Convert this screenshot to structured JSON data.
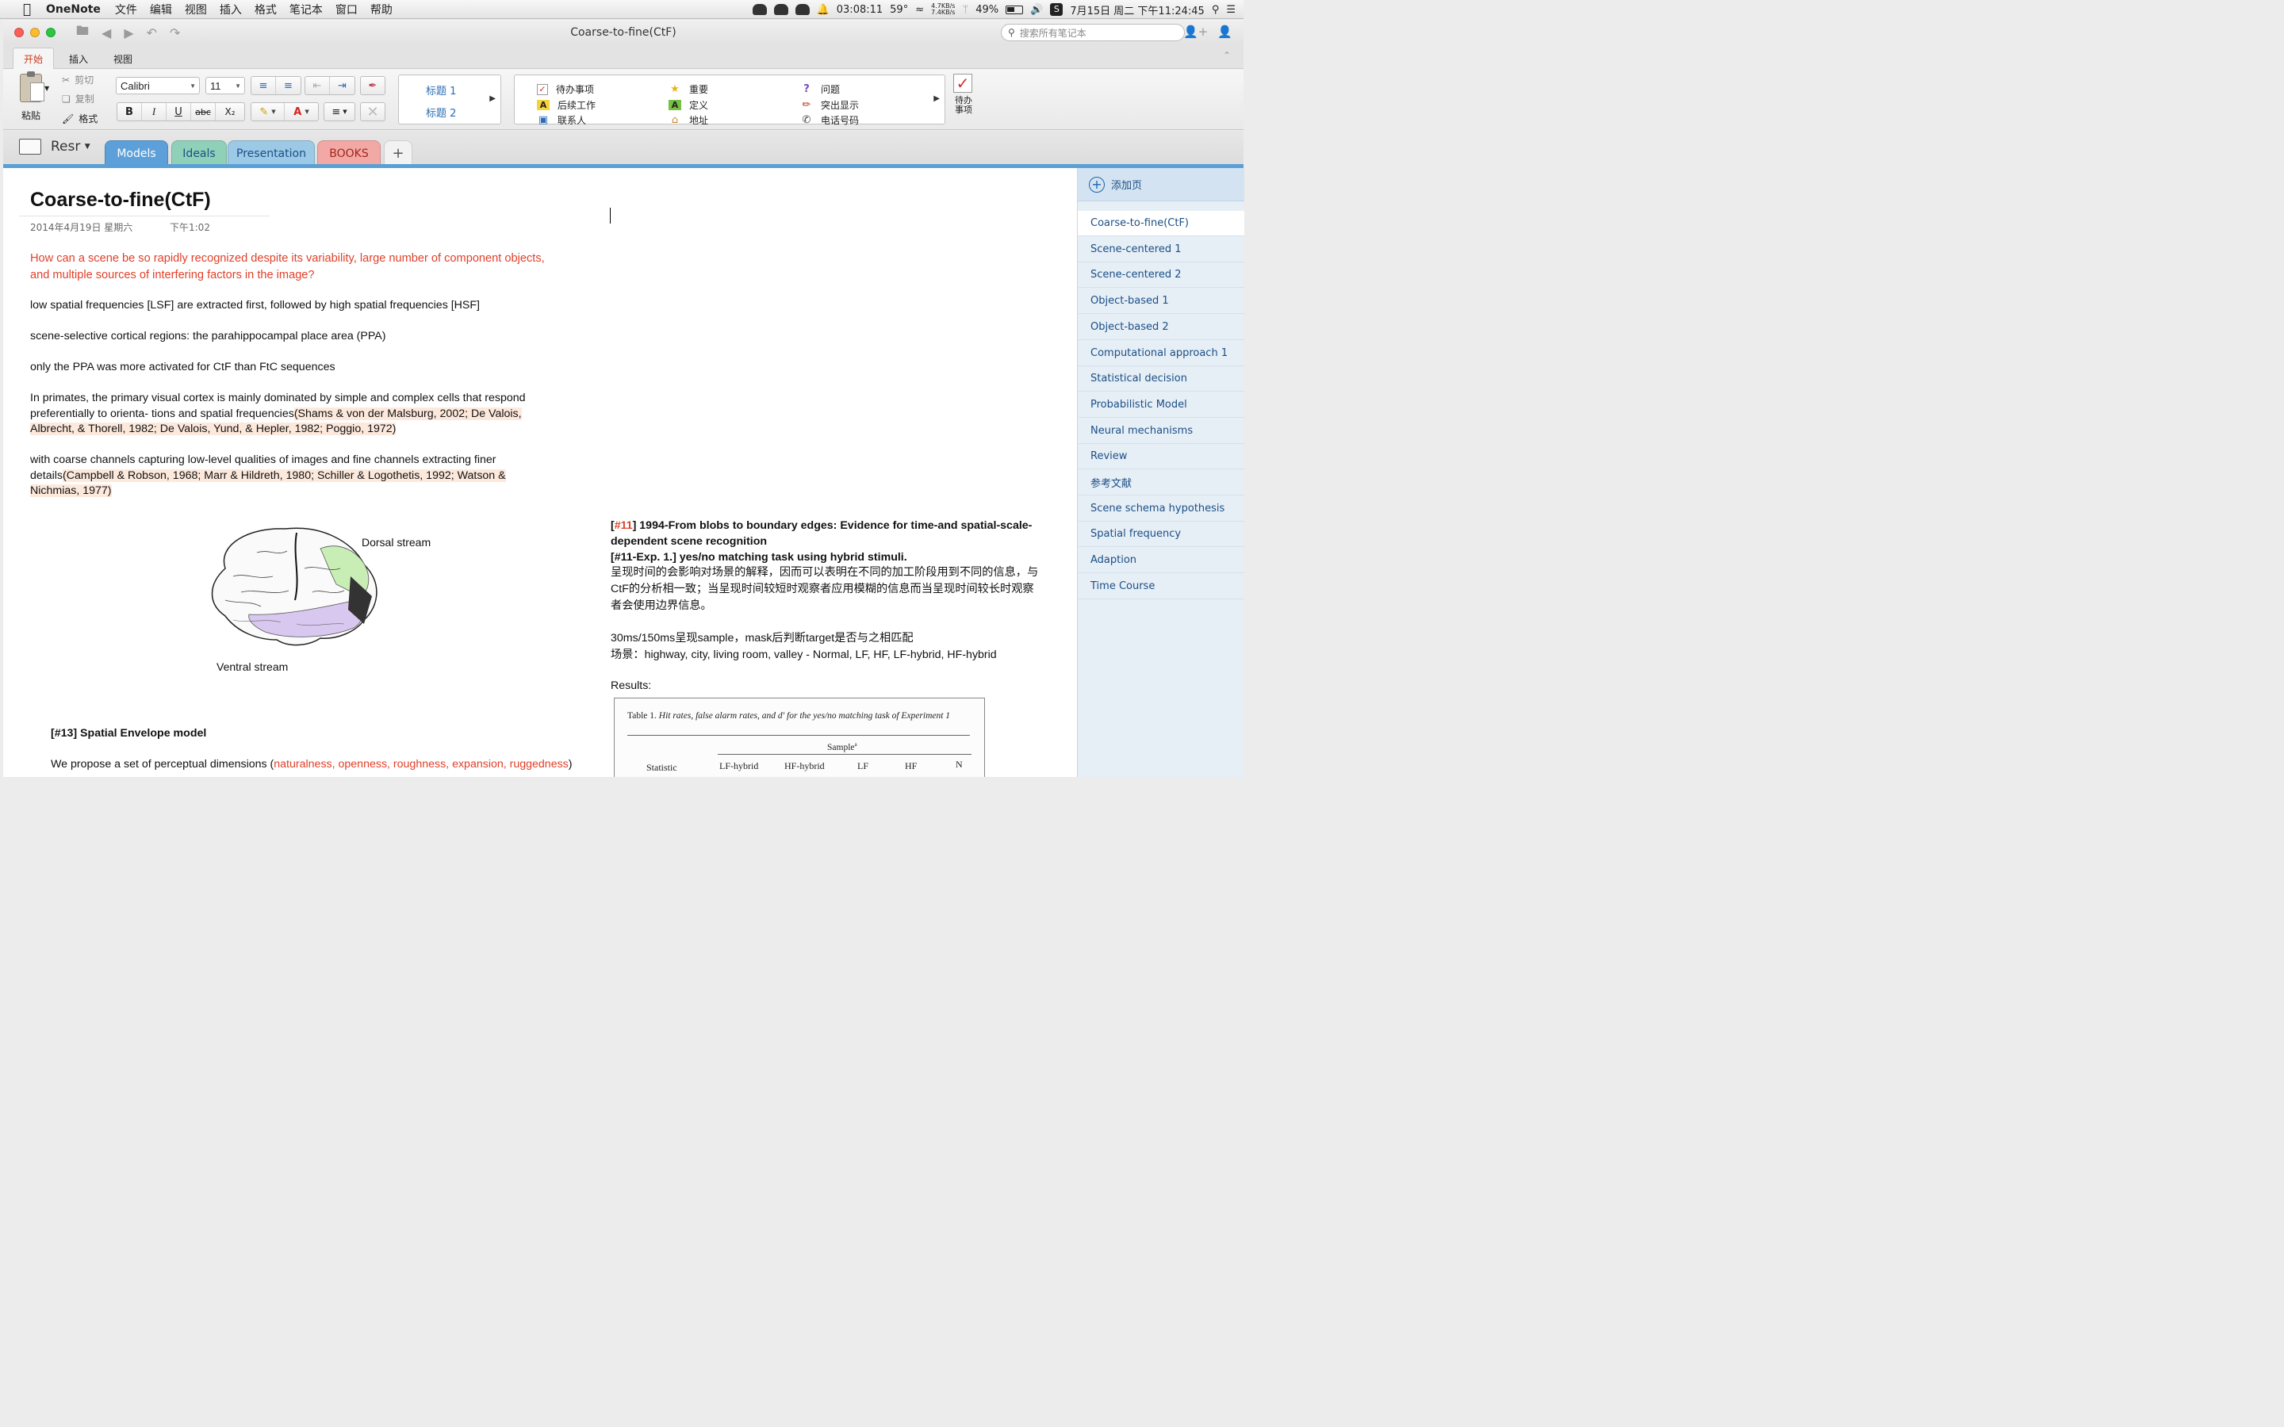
{
  "menubar": {
    "app_name": "OneNote",
    "items": [
      "文件",
      "编辑",
      "视图",
      "插入",
      "格式",
      "笔记本",
      "窗口",
      "帮助"
    ],
    "status": {
      "timer": "03:08:11",
      "temperature": "59°",
      "net_up": "4.7KB/s",
      "net_down": "7.4KB/s",
      "battery": "49%",
      "datetime": "7月15日 周二 下午11:24:45"
    }
  },
  "window": {
    "title": "Coarse-to-fine(CtF)",
    "search_placeholder": "搜索所有笔记本"
  },
  "ribbon_tabs": [
    "开始",
    "插入",
    "视图"
  ],
  "ribbon": {
    "paste": "粘贴",
    "cut": "剪切",
    "copy": "复制",
    "format": "格式",
    "font": "Calibri",
    "size": "11",
    "bold": "B",
    "italic": "I",
    "underline": "U",
    "strike": "abc",
    "subscript": "X₂",
    "styles": [
      "标题 1",
      "标题 2"
    ],
    "tags": [
      {
        "label": "待办事项",
        "icon": "checkbox-icon"
      },
      {
        "label": "后续工作",
        "icon": "a-yellow-icon"
      },
      {
        "label": "联系人",
        "icon": "contact-card-icon"
      },
      {
        "label": "重要",
        "icon": "star-icon"
      },
      {
        "label": "定义",
        "icon": "a-green-icon"
      },
      {
        "label": "地址",
        "icon": "house-icon"
      },
      {
        "label": "问题",
        "icon": "question-icon"
      },
      {
        "label": "突出显示",
        "icon": "highlighter-icon"
      },
      {
        "label": "电话号码",
        "icon": "phone-icon"
      }
    ],
    "todo_big": "待办事项"
  },
  "notebook": {
    "name": "Resr",
    "sections": [
      {
        "label": "Models",
        "color": "#5d9fd8",
        "active": true
      },
      {
        "label": "Ideals",
        "color": "#8fd0b8"
      },
      {
        "label": "Presentation",
        "color": "#9cc9e6"
      },
      {
        "label": "BOOKS",
        "color": "#f2a9a5"
      }
    ],
    "add_section": "+"
  },
  "page": {
    "title": "Coarse-to-fine(CtF)",
    "date": "2014年4月19日 星期六",
    "time": "下午1:02",
    "question": "How can a scene be so rapidly recognized despite its variability, large number of component objects, and multiple sources of interfering factors in the image?",
    "p1": "low spatial frequencies [LSF] are extracted first, followed by high spatial frequencies [HSF]",
    "p2": "scene-selective cortical regions: the parahippocampal place area (PPA)",
    "p3": "only the PPA was more activated for CtF than FtC sequences",
    "p4_text": "In primates, the primary visual cortex is mainly dominated by simple and complex cells that respond preferentially to orienta- tions and spatial frequencies",
    "p4_cite": "(Shams & von der Malsburg, 2002; De Valois, Albrecht, & Thorell, 1982; De Valois, Yund, & Hepler, 1982; Poggio, 1972)",
    "p5_text": "with coarse channels capturing low-level qualities of images and fine channels extracting finer details",
    "p5_cite": "(Campbell & Robson, 1968; Marr & Hildreth, 1980; Schiller & Logothetis, 1992; Watson & Nichmias, 1977)",
    "brain": {
      "dorsal": "Dorsal stream",
      "ventral": "Ventral stream"
    },
    "ref13": "[#13] Spatial Envelope model",
    "p6_text": "We propose a set of perceptual dimensions (",
    "p6_red": "naturalness, openness, roughness, expansion, ruggedness",
    "p6_end": ")",
    "right": {
      "ref11_open": "[",
      "ref11_num": "#11",
      "ref11_title": "] 1994-From blobs to boundary edges: Evidence for time-and spatial-scale-dependent scene recognition",
      "exp": "[#11-Exp. 1.] yes/no matching task using hybrid stimuli.",
      "cn": "呈现时间的会影响对场景的解释，因而可以表明在不同的加工阶段用到不同的信息，与CtF的分析相一致；当呈现时间较短时观察者应用模糊的信息而当呈现时间较长时观察者会使用边界信息。",
      "red_line": "30ms/150ms呈现sample，mask后判断target是否与之相匹配",
      "scenes": "场景：highway, city, living room, valley - Normal, LF, HF, LF-hybrid, HF-hybrid",
      "results": "Results:",
      "table_caption_label": "Table 1.",
      "table_caption": "Hit rates, false alarm rates, and d′ for the yes/no matching task of Experiment 1",
      "table_sample": "Sample",
      "table_sup": "a",
      "table_cols": [
        "Statistic",
        "LF-hybrid",
        "HF-hybrid",
        "LF",
        "HF",
        "N"
      ]
    }
  },
  "pagelist": {
    "add_page": "添加页",
    "items": [
      "Coarse-to-fine(CtF)",
      "Scene-centered 1",
      "Scene-centered 2",
      "Object-based 1",
      "Object-based 2",
      "Computational approach 1",
      "Statistical decision",
      "Probabilistic Model",
      "Neural mechanisms",
      "Review",
      "参考文献",
      "Scene schema hypothesis",
      "Spatial frequency",
      "Adaption",
      "Time Course"
    ]
  }
}
